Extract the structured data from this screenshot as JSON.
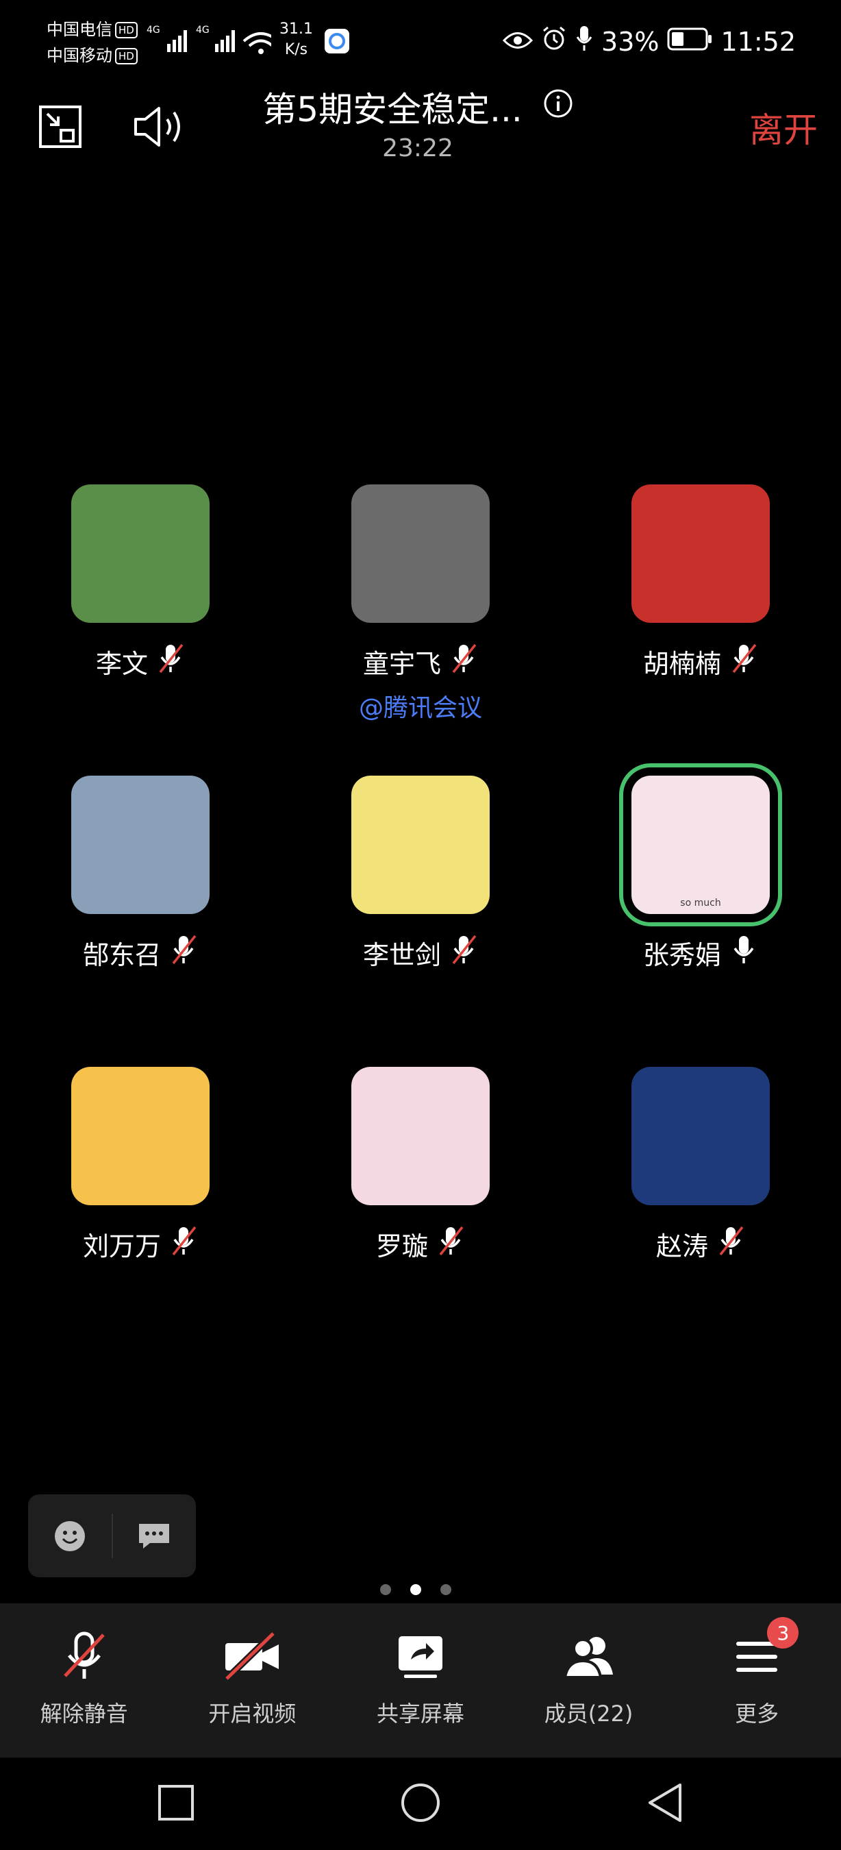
{
  "status_bar": {
    "carrier1": "中国电信",
    "carrier2": "中国移动",
    "hd": "HD",
    "net_type": "4G",
    "speed_value": "31.1",
    "speed_unit": "K/s",
    "battery": "33%",
    "time": "11:52"
  },
  "header": {
    "title": "第5期安全稳定...",
    "timer": "23:22",
    "leave_label": "离开"
  },
  "participants": [
    {
      "name": "李文",
      "mic": "muted",
      "bg": "#5a8f4a"
    },
    {
      "name": "童宇飞",
      "mic": "muted",
      "bg": "#6b6b6b",
      "tag": "@腾讯会议"
    },
    {
      "name": "胡楠楠",
      "mic": "muted",
      "bg": "#c8302c"
    },
    {
      "name": "郜东召",
      "mic": "muted",
      "bg": "#8aa0b8"
    },
    {
      "name": "李世剑",
      "mic": "muted",
      "bg": "#f2e27a"
    },
    {
      "name": "张秀娟",
      "mic": "on",
      "bg": "#f6e3ea",
      "avatar_text": "so much",
      "speaking": true
    },
    {
      "name": "刘万万",
      "mic": "muted",
      "bg": "#f6c24b"
    },
    {
      "name": "罗璇",
      "mic": "muted",
      "bg": "#f4d9e2"
    },
    {
      "name": "赵涛",
      "mic": "muted",
      "bg": "#1e3a7a"
    }
  ],
  "pager": {
    "count": 3,
    "active": 1
  },
  "toolbar": {
    "unmute": "解除静音",
    "video": "开启视频",
    "share": "共享屏幕",
    "members": "成员(22)",
    "more": "更多",
    "more_badge": "3"
  }
}
